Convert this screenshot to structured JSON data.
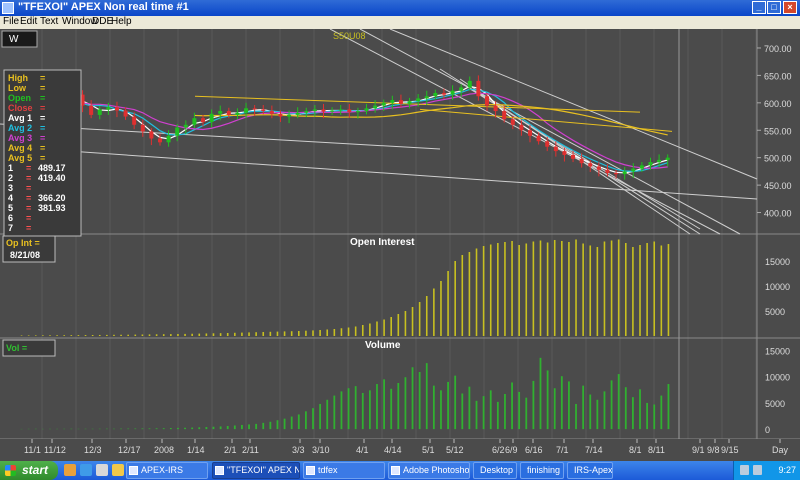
{
  "window": {
    "title": "\"TFEXOI\" APEX Non real time #1",
    "controls": {
      "minimize": "_",
      "maximize": "□",
      "close": "×"
    }
  },
  "menu": {
    "items": [
      "File",
      "Edit",
      "Text",
      "Window",
      "DDE",
      "Help"
    ]
  },
  "chart_data": [
    {
      "type": "candlestick",
      "panel": "price",
      "period_box": "W",
      "annotation": "S50U08",
      "y_axis_ticks": [
        "700.00",
        "650.00",
        "600.00",
        "550.00",
        "500.00",
        "450.00",
        "400.00"
      ],
      "ylim": [
        370,
        720
      ],
      "legend": [
        {
          "label": "High",
          "sep": "=",
          "value": "",
          "color": "#e8c020"
        },
        {
          "label": "Low",
          "sep": "=",
          "value": "",
          "color": "#e8c020"
        },
        {
          "label": "Open",
          "sep": "=",
          "value": "",
          "color": "#20c020"
        },
        {
          "label": "Close",
          "sep": "=",
          "value": "",
          "color": "#e04040"
        },
        {
          "label": "Avg 1",
          "sep": "=",
          "value": "",
          "color": "#ffffff"
        },
        {
          "label": "Avg 2",
          "sep": "=",
          "value": "",
          "color": "#20c0e0"
        },
        {
          "label": "Avg 3",
          "sep": "=",
          "value": "",
          "color": "#d040d0"
        },
        {
          "label": "Avg 4",
          "sep": "=",
          "value": "",
          "color": "#e8c020"
        },
        {
          "label": "Avg 5",
          "sep": "=",
          "value": "",
          "color": "#e8c020"
        },
        {
          "label": "1",
          "sep": "=",
          "value": "489.17",
          "color": "#ffffff"
        },
        {
          "label": "2",
          "sep": "=",
          "value": "419.40",
          "color": "#ffffff"
        },
        {
          "label": "3",
          "sep": "=",
          "value": "",
          "color": "#ffffff"
        },
        {
          "label": "4",
          "sep": "=",
          "value": "366.20",
          "color": "#ffffff"
        },
        {
          "label": "5",
          "sep": "=",
          "value": "381.93",
          "color": "#ffffff"
        },
        {
          "label": "6",
          "sep": "=",
          "value": "",
          "color": "#ffffff"
        },
        {
          "label": "7",
          "sep": "=",
          "value": "",
          "color": "#ffffff"
        }
      ],
      "series_close": [
        590,
        605,
        612,
        598,
        585,
        600,
        615,
        595,
        578,
        588,
        592,
        586,
        575,
        560,
        548,
        535,
        528,
        540,
        555,
        560,
        572,
        565,
        580,
        585,
        578,
        582,
        590,
        588,
        585,
        580,
        575,
        578,
        582,
        585,
        588,
        584,
        586,
        588,
        583,
        585,
        590,
        595,
        600,
        605,
        598,
        603,
        608,
        612,
        618,
        615,
        622,
        628,
        640,
        612,
        595,
        585,
        570,
        560,
        550,
        540,
        530,
        520,
        512,
        505,
        498,
        490,
        484,
        478,
        472,
        470,
        475,
        480,
        486,
        492,
        496,
        500
      ],
      "colors": {
        "up": "#20c020",
        "down": "#e03030",
        "avg_white": "#ffffff",
        "avg_cyan": "#20c0e0",
        "avg_magenta": "#d040d0",
        "avg_yellow": "#e8c020"
      }
    },
    {
      "type": "bar",
      "panel": "open_interest",
      "title": "Open  Interest",
      "legend_label": "Op  Int  =",
      "legend_date": "8/21/08",
      "y_axis_ticks": [
        "15000",
        "10000",
        "5000"
      ],
      "ylim": [
        0,
        20000
      ],
      "color": "#c8c020",
      "values": [
        100,
        110,
        120,
        130,
        140,
        150,
        160,
        170,
        180,
        190,
        200,
        210,
        220,
        240,
        250,
        260,
        280,
        300,
        320,
        340,
        360,
        380,
        400,
        420,
        450,
        480,
        510,
        540,
        570,
        600,
        640,
        680,
        720,
        760,
        800,
        840,
        880,
        920,
        960,
        1000,
        1060,
        1120,
        1200,
        1300,
        1400,
        1550,
        1700,
        1900,
        2200,
        2500,
        2900,
        3300,
        3800,
        4400,
        5000,
        5800,
        6800,
        8000,
        9500,
        11000,
        13000,
        15000,
        16200,
        16800,
        17500,
        18000,
        18300,
        18600,
        18800,
        19000,
        18200,
        18500,
        18900,
        19100,
        18700,
        19200,
        19000,
        18800,
        19300,
        18500,
        18100,
        17800,
        18900,
        19100,
        19300,
        18600,
        17800,
        18200,
        18600,
        18900,
        18100,
        18400
      ]
    },
    {
      "type": "bar",
      "panel": "volume",
      "title": "Volume",
      "legend_label": "Vol     =",
      "y_axis_ticks": [
        "15000",
        "10000",
        "5000",
        "0"
      ],
      "ylim": [
        -1500,
        17000
      ],
      "color": "#30b030",
      "values": [
        40,
        50,
        60,
        45,
        55,
        50,
        60,
        70,
        55,
        65,
        60,
        70,
        80,
        75,
        90,
        100,
        110,
        120,
        130,
        150,
        170,
        200,
        230,
        260,
        300,
        350,
        400,
        460,
        520,
        600,
        700,
        800,
        900,
        1000,
        1200,
        1400,
        1700,
        2000,
        2400,
        2800,
        3400,
        4000,
        4800,
        5600,
        6400,
        7200,
        7800,
        8200,
        6900,
        7400,
        8600,
        9500,
        7700,
        8800,
        9900,
        11800,
        10900,
        12600,
        8300,
        7400,
        9000,
        10200,
        6800,
        8100,
        5400,
        6300,
        7400,
        5200,
        6700,
        8900,
        7100,
        6000,
        9200,
        13600,
        11200,
        7800,
        10100,
        9100,
        4800,
        8300,
        6600,
        5600,
        7200,
        9300,
        10500,
        8000,
        6100,
        7600,
        5000,
        4700,
        6400,
        8600
      ]
    },
    {
      "type": "axis",
      "panel": "date_axis",
      "x_tick_labels": [
        "11/1",
        "11/12",
        "12/3",
        "12/17",
        "2008",
        "1/14",
        "2/1",
        "2/11",
        "3/3",
        "3/10",
        "4/1",
        "4/14",
        "5/1",
        "5/12",
        "6/2",
        "6/9",
        "6/16",
        "7/1",
        "7/14",
        "8/1",
        "8/11",
        "9/1",
        "9/8",
        "9/15",
        "Day"
      ]
    }
  ],
  "taskbar": {
    "start_label": "start",
    "buttons": [
      {
        "label": "APEX-IRS",
        "active": false
      },
      {
        "label": "\"TFEXOI\" APEX N...",
        "active": true
      },
      {
        "label": "tdfex",
        "active": false
      },
      {
        "label": "Adobe Photoshop",
        "active": false
      },
      {
        "label": "Desktop",
        "active": false
      },
      {
        "label": "finishing",
        "active": false
      },
      {
        "label": "IRS-Apexd",
        "active": false
      }
    ],
    "clock": "9:27"
  }
}
